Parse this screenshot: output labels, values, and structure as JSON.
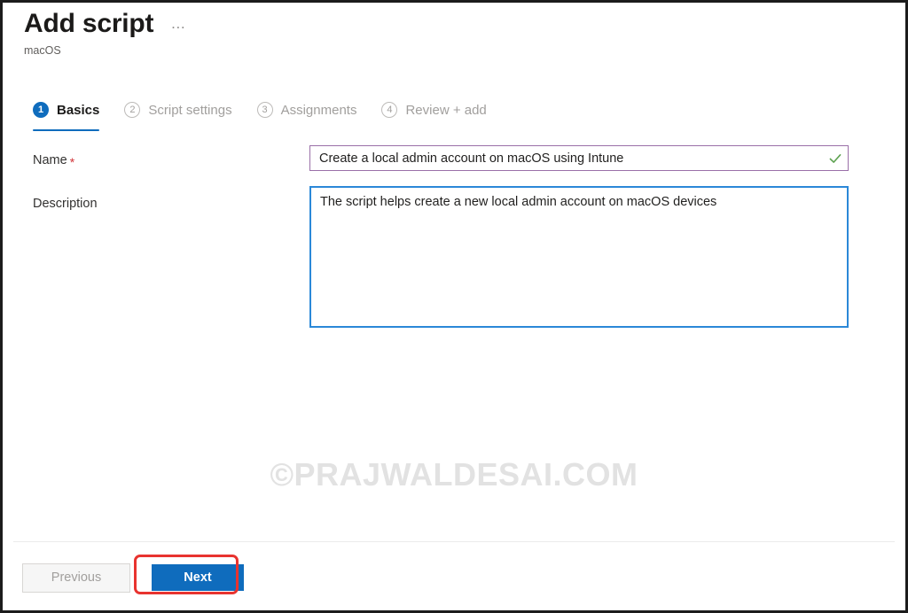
{
  "header": {
    "title": "Add script",
    "subtitle": "macOS",
    "ellipsis": "…",
    "ellipsis_name": "more-options-icon"
  },
  "wizard": {
    "tabs": [
      {
        "number": "1",
        "label": "Basics",
        "state": "active"
      },
      {
        "number": "2",
        "label": "Script settings",
        "state": "inactive"
      },
      {
        "number": "3",
        "label": "Assignments",
        "state": "inactive"
      },
      {
        "number": "4",
        "label": "Review + add",
        "state": "inactive"
      }
    ]
  },
  "form": {
    "name": {
      "label": "Name",
      "required_marker": "*",
      "value": "Create a local admin account on macOS using Intune",
      "placeholder": "",
      "valid_icon": "checkmark-icon",
      "border_color": "#9a6fa8",
      "valid_color": "#5ca14f"
    },
    "description": {
      "label": "Description",
      "value": "The script helps create a new local admin account on macOS devices",
      "placeholder": "",
      "border_color": "#2b88d8"
    }
  },
  "watermark": {
    "text": "©PRAJWALDESAI.COM",
    "color": "#e2e2e2"
  },
  "footer": {
    "previous_label": "Previous",
    "next_label": "Next",
    "next_accent": "#0f6cbd",
    "annotation_color": "#e8332f"
  }
}
